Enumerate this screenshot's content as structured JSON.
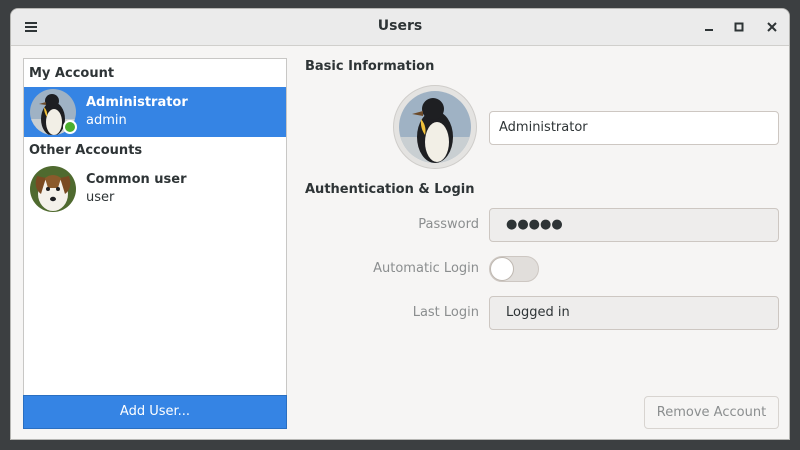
{
  "window": {
    "title": "Users"
  },
  "titlebar_icons": {
    "menu": "hamburger-menu-icon",
    "minimize": "minimize-icon",
    "maximize": "maximize-icon",
    "close": "close-icon"
  },
  "sidebar": {
    "my_account_label": "My Account",
    "other_accounts_label": "Other Accounts",
    "my_account": {
      "name": "Administrator",
      "login": "admin",
      "avatar": "penguin-avatar",
      "status": "online",
      "selected": true
    },
    "other_accounts": [
      {
        "name": "Common user",
        "login": "user",
        "avatar": "dog-avatar"
      }
    ],
    "add_user_label": "Add User..."
  },
  "main": {
    "basic_info_heading": "Basic Information",
    "full_name_value": "Administrator",
    "auth_heading": "Authentication & Login",
    "password_label": "Password",
    "password_value": "●●●●●",
    "auto_login_label": "Automatic Login",
    "auto_login_enabled": false,
    "last_login_label": "Last Login",
    "last_login_value": "Logged in",
    "remove_account_label": "Remove Account"
  },
  "colors": {
    "accent": "#3584e4",
    "online": "#4caf2e",
    "muted_text": "#8b8e8f"
  }
}
